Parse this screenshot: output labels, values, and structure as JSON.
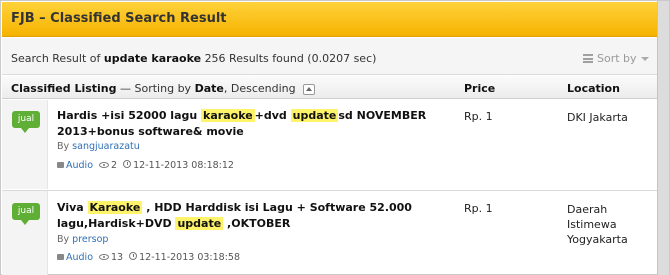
{
  "header": {
    "title": "FJB – Classified Search Result"
  },
  "search": {
    "prefix": "Search Result of",
    "query": "update karaoke",
    "results": "256 Results found (0.0207 sec)",
    "sort_label": "Sort by"
  },
  "columns": {
    "listing_label": "Classified Listing",
    "sorting_text": "— Sorting by",
    "sort_field": "Date",
    "sort_order": "Descending",
    "price": "Price",
    "location": "Location"
  },
  "listings": [
    {
      "badge": "jual",
      "title_parts": [
        "Hardis +isi 52000 lagu ",
        "karaoke",
        "+dvd ",
        "update",
        "sd NOVEMBER 2013+bonus software& movie"
      ],
      "by_label": "By",
      "seller": "sangjuarazatu",
      "category": "Audio",
      "views": "2",
      "date": "12-11-2013 08:18:12",
      "price": "Rp. 1",
      "location": "DKI Jakarta"
    },
    {
      "badge": "jual",
      "title_parts": [
        "Viva ",
        "Karaoke",
        " , HDD Harddisk isi Lagu + Software 52.000 lagu,Hardisk+DVD ",
        "update",
        " ,OKTOBER"
      ],
      "by_label": "By",
      "seller": "prersop",
      "category": "Audio",
      "views": "13",
      "date": "12-11-2013 03:18:58",
      "price": "Rp. 1",
      "location": "Daerah Istimewa Yogyakarta"
    }
  ]
}
